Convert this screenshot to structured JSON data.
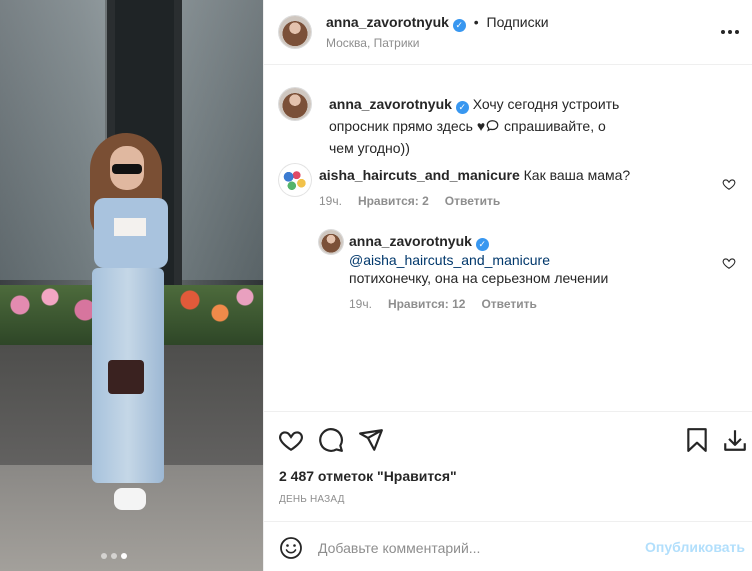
{
  "photo": {
    "carousel_total": 3,
    "carousel_active": 3
  },
  "header": {
    "username": "anna_zavorotnyuk",
    "separator": "•",
    "follow_label": "Подписки",
    "location": "Москва, Патрики",
    "avatar_icon": "profile-photo",
    "more_icon": "more-horizontal-icon"
  },
  "caption": {
    "username": "anna_zavorotnyuk",
    "text_before": "Хочу сегодня устроить опросник прямо здесь ",
    "emoji_heart": "♥",
    "emoji_bubble": "💬",
    "text_after": " спрашивайте, о чем угодно))"
  },
  "comments": [
    {
      "username": "aisha_haircuts_and_manicure",
      "text": "Как ваша мама?",
      "time": "19ч.",
      "likes": "Нравится: 2",
      "reply_label": "Ответить"
    },
    {
      "username": "anna_zavorotnyuk",
      "mention": "@aisha_haircuts_and_manicure",
      "text": "потихонечку, она на серьезном лечении",
      "time": "19ч.",
      "likes": "Нравится: 12",
      "reply_label": "Ответить"
    }
  ],
  "actions": {
    "likes_count": "2 487 отметок \"Нравится\"",
    "date": "ДЕНЬ НАЗАД",
    "icons": [
      "heart-icon",
      "comment-icon",
      "share-icon",
      "bookmark-icon",
      "download-icon"
    ]
  },
  "add_comment": {
    "placeholder": "Добавьте комментарий...",
    "publish_label": "Опубликовать"
  },
  "colors": {
    "link": "#00376b",
    "muted": "#8e8e8e",
    "publish_disabled": "#b2dffc",
    "verified": "#3897f0"
  }
}
